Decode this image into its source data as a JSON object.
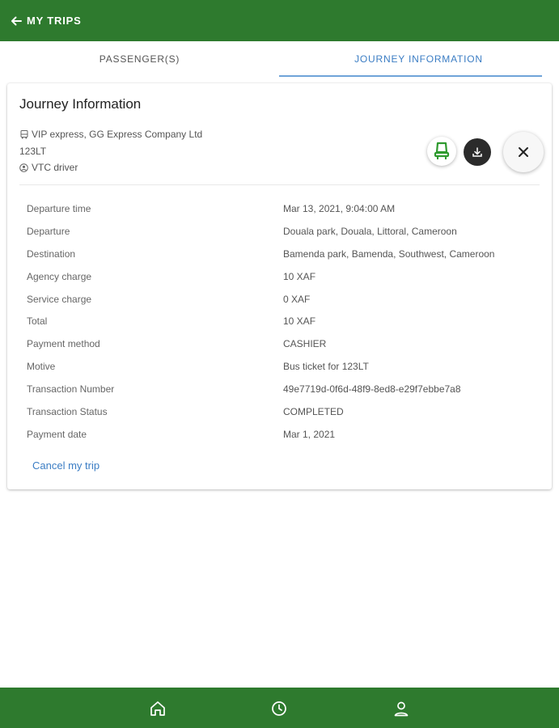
{
  "header": {
    "title": "MY TRIPS",
    "back_icon": "arrow-left-icon"
  },
  "tabs": [
    {
      "label": "PASSENGER(S)",
      "active": false
    },
    {
      "label": "JOURNEY INFORMATION",
      "active": true
    }
  ],
  "card": {
    "title": "Journey Information",
    "company": "VIP express, GG Express Company Ltd",
    "plate": "123LT",
    "driver": "VTC driver"
  },
  "actions": {
    "seat_icon": "seat-icon",
    "download_icon": "download-icon",
    "close_icon": "close-icon"
  },
  "details": [
    {
      "label": "Departure time",
      "value": "Mar 13, 2021, 9:04:00 AM"
    },
    {
      "label": "Departure",
      "value": "Douala park, Douala, Littoral, Cameroon"
    },
    {
      "label": "Destination",
      "value": "Bamenda park, Bamenda, Southwest, Cameroon"
    },
    {
      "label": "Agency charge",
      "value": "10 XAF"
    },
    {
      "label": "Service charge",
      "value": "0 XAF"
    },
    {
      "label": "Total",
      "value": "10 XAF"
    },
    {
      "label": "Payment method",
      "value": "CASHIER"
    },
    {
      "label": "Motive",
      "value": "Bus ticket for 123LT"
    },
    {
      "label": "Transaction Number",
      "value": "49e7719d-0f6d-48f9-8ed8-e29f7ebbe7a8"
    },
    {
      "label": "Transaction Status",
      "value": "COMPLETED"
    },
    {
      "label": "Payment date",
      "value": "Mar 1, 2021"
    }
  ],
  "cancel_label": "Cancel my trip",
  "bottom_nav": [
    "home-icon",
    "history-clock-icon",
    "profile-icon"
  ],
  "colors": {
    "brand_green": "#2e7a2e",
    "accent_blue": "#3b7dc4",
    "seat_green": "#2e9a2e"
  }
}
